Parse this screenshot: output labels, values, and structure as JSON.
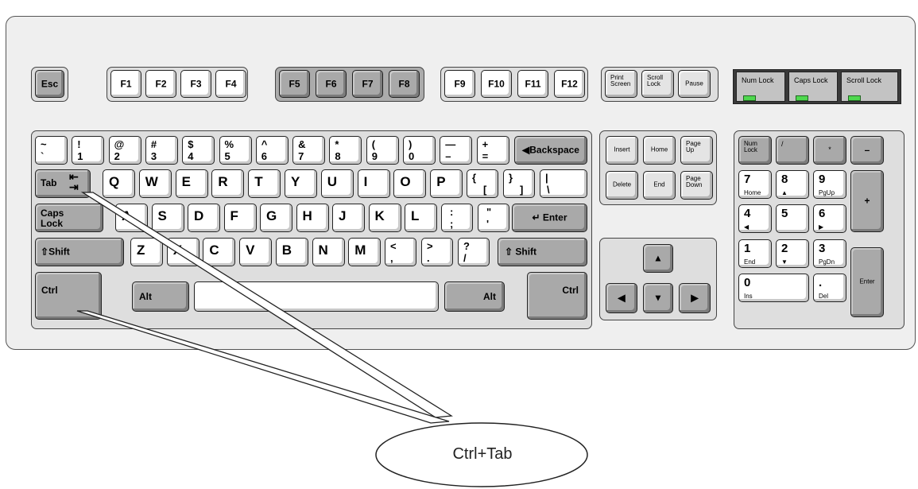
{
  "function_row": {
    "esc": "Esc",
    "f_keys": [
      "F1",
      "F2",
      "F3",
      "F4",
      "F5",
      "F6",
      "F7",
      "F8",
      "F9",
      "F10",
      "F11",
      "F12"
    ],
    "print_screen": "Print\nScreen",
    "scroll_lock": "Scroll\nLock",
    "pause": "Pause"
  },
  "lock_indicators": [
    "Num\nLock",
    "Caps\nLock",
    "Scroll\nLock"
  ],
  "number_row": [
    {
      "top": "~",
      "bottom": "`"
    },
    {
      "top": "!",
      "bottom": "1"
    },
    {
      "top": "@",
      "bottom": "2"
    },
    {
      "top": "#",
      "bottom": "3"
    },
    {
      "top": "$",
      "bottom": "4"
    },
    {
      "top": "%",
      "bottom": "5"
    },
    {
      "top": "^",
      "bottom": "6"
    },
    {
      "top": "&",
      "bottom": "7"
    },
    {
      "top": "*",
      "bottom": "8"
    },
    {
      "top": "(",
      "bottom": "9"
    },
    {
      "top": ")",
      "bottom": "0"
    },
    {
      "top": "—",
      "bottom": "–"
    },
    {
      "top": "+",
      "bottom": "="
    }
  ],
  "backspace": "Backspace",
  "tab": "Tab",
  "qwerty_row": [
    "Q",
    "W",
    "E",
    "R",
    "T",
    "Y",
    "U",
    "I",
    "O",
    "P"
  ],
  "bracket_keys": [
    {
      "top": "{",
      "bottom": "["
    },
    {
      "top": "}",
      "bottom": "]"
    },
    {
      "top": "|",
      "bottom": "\\"
    }
  ],
  "caps_lock": "Caps\nLock",
  "home_row": [
    "A",
    "S",
    "D",
    "F",
    "G",
    "H",
    "J",
    "K",
    "L"
  ],
  "home_punct": [
    {
      "top": ":",
      "bottom": ";"
    },
    {
      "top": "\"",
      "bottom": "'"
    }
  ],
  "enter": "Enter",
  "shift": "Shift",
  "bottom_row_letters": [
    "Z",
    "X",
    "C",
    "V",
    "B",
    "N",
    "M"
  ],
  "bottom_punct": [
    {
      "top": "<",
      "bottom": ","
    },
    {
      "top": ">",
      "bottom": "."
    },
    {
      "top": "?",
      "bottom": "/"
    }
  ],
  "ctrl": "Ctrl",
  "alt": "Alt",
  "nav_cluster": [
    "Insert",
    "Home",
    "Page\nUp",
    "Delete",
    "End",
    "Page\nDown"
  ],
  "numpad": {
    "num_lock": "Num\nLock",
    "slash": "/",
    "star": "*",
    "minus": "–",
    "plus": "+",
    "enter": "Enter",
    "seven": {
      "num": "7",
      "sub": "Home"
    },
    "eight": {
      "num": "8",
      "sub": "▲"
    },
    "nine": {
      "num": "9",
      "sub": "PgUp"
    },
    "four": {
      "num": "4",
      "sub": "◀"
    },
    "five": {
      "num": "5",
      "sub": ""
    },
    "six": {
      "num": "6",
      "sub": "▶"
    },
    "one": {
      "num": "1",
      "sub": "End"
    },
    "two": {
      "num": "2",
      "sub": "▼"
    },
    "three": {
      "num": "3",
      "sub": "PgDn"
    },
    "zero": {
      "num": "0",
      "sub": "Ins"
    },
    "dot": {
      "num": ".",
      "sub": "Del"
    }
  },
  "callout": "Ctrl+Tab",
  "colors": {
    "led": "#4fd84f",
    "gray_key": "#a9a9a9",
    "white_key": "#ffffff",
    "board": "#efefef"
  }
}
